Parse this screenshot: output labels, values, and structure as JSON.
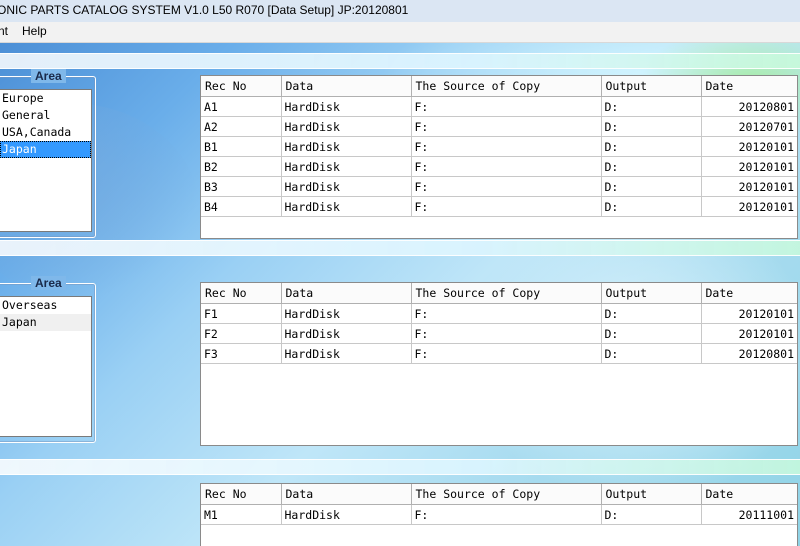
{
  "window": {
    "title": "ONIC PARTS CATALOG SYSTEM V1.0 L50 R070 [Data Setup] JP:20120801"
  },
  "menu": {
    "items": [
      "nt",
      "Help"
    ]
  },
  "panel1": {
    "group_title": "Area",
    "list": [
      "Europe",
      "General",
      "USA,Canada",
      "Japan"
    ],
    "selected": "Japan",
    "columns": [
      "Rec No",
      "Data",
      "The Source of Copy",
      "Output",
      "Date"
    ],
    "rows": [
      [
        "A1",
        "HardDisk",
        "F:",
        "D:",
        "20120801"
      ],
      [
        "A2",
        "HardDisk",
        "F:",
        "D:",
        "20120701"
      ],
      [
        "B1",
        "HardDisk",
        "F:",
        "D:",
        "20120101"
      ],
      [
        "B2",
        "HardDisk",
        "F:",
        "D:",
        "20120101"
      ],
      [
        "B3",
        "HardDisk",
        "F:",
        "D:",
        "20120101"
      ],
      [
        "B4",
        "HardDisk",
        "F:",
        "D:",
        "20120101"
      ]
    ]
  },
  "panel2": {
    "group_title": "Area",
    "list": [
      "Overseas",
      "Japan"
    ],
    "highlighted": "Japan",
    "columns": [
      "Rec No",
      "Data",
      "The Source of Copy",
      "Output",
      "Date"
    ],
    "rows": [
      [
        "F1",
        "HardDisk",
        "F:",
        "D:",
        "20120101"
      ],
      [
        "F2",
        "HardDisk",
        "F:",
        "D:",
        "20120101"
      ],
      [
        "F3",
        "HardDisk",
        "F:",
        "D:",
        "20120801"
      ]
    ]
  },
  "panel3": {
    "columns": [
      "Rec No",
      "Data",
      "The Source of Copy",
      "Output",
      "Date"
    ],
    "rows": [
      [
        "M1",
        "HardDisk",
        "F:",
        "D:",
        "20111001"
      ]
    ]
  },
  "colors": {
    "selection": "#3399ff",
    "titlebar": "#dbe6f3"
  }
}
